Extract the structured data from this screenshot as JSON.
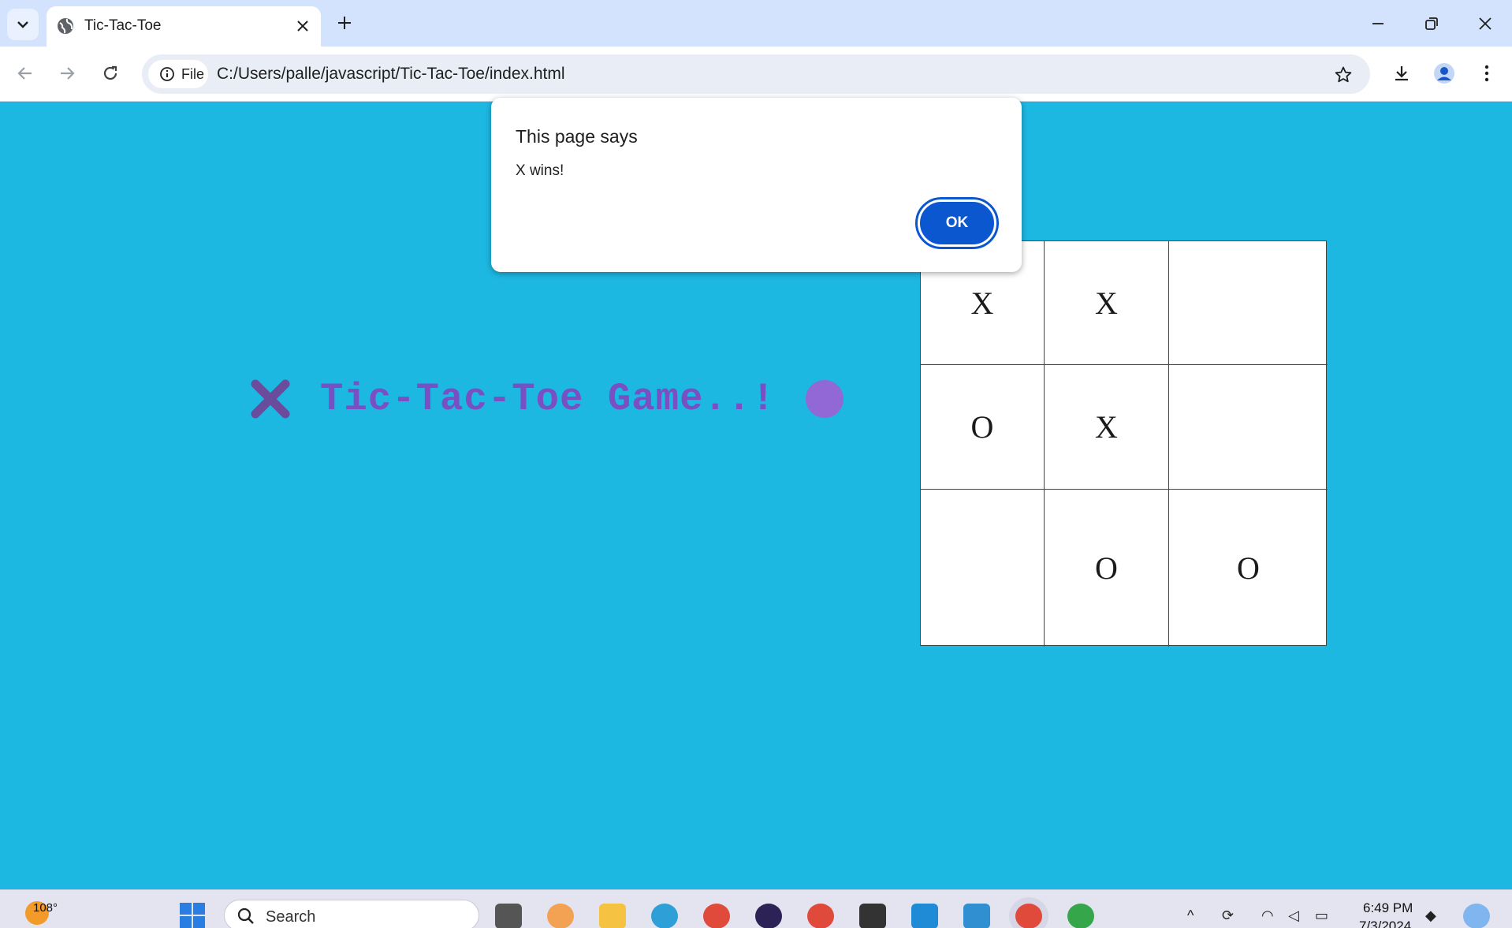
{
  "browser": {
    "tab_title": "Tic-Tac-Toe",
    "site_chip": "File",
    "url": "C:/Users/palle/javascript/Tic-Tac-Toe/index.html"
  },
  "page": {
    "heading": "Tic-Tac-Toe Game..!",
    "board": [
      [
        "X",
        "X",
        ""
      ],
      [
        "O",
        "X",
        ""
      ],
      [
        "",
        "O",
        "O"
      ]
    ]
  },
  "dialog": {
    "title": "This page says",
    "message": "X wins!",
    "ok_label": "OK"
  },
  "taskbar": {
    "weather_temp": "108°",
    "search_placeholder": "Search",
    "time": "6:49 PM",
    "date": "7/3/2024"
  },
  "colors": {
    "page_background": "#1db8e2",
    "heading": "#7b4fc4",
    "x_mark": "#6a4b9c",
    "o_mark": "#9168d6",
    "ok_button": "#0b57d0"
  },
  "icons": [
    "tab-search-icon",
    "globe-icon",
    "close-icon",
    "plus-icon",
    "minimize-icon",
    "restore-icon",
    "back-arrow-icon",
    "forward-arrow-icon",
    "reload-icon",
    "info-icon",
    "star-icon",
    "download-icon",
    "profile-icon",
    "kebab-menu-icon"
  ]
}
